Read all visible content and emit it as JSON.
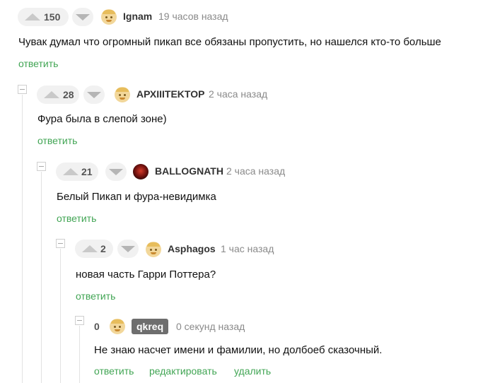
{
  "comments": [
    {
      "score": "150",
      "username": "Ignam",
      "time": "19 часов назад",
      "text": "Чувак думал что огромный пикап все обязаны пропустить, но нашелся кто-то больше",
      "actions": [
        "ответить"
      ]
    },
    {
      "score": "28",
      "username": "АРХIIITEKTOP",
      "time": "2 часа назад",
      "text": "Фура была в слепой зоне)",
      "actions": [
        "ответить"
      ]
    },
    {
      "score": "21",
      "username": "BALLOGNATH",
      "time": "2 часа назад",
      "text": "Белый Пикап и фура-невидимка",
      "actions": [
        "ответить"
      ]
    },
    {
      "score": "2",
      "username": "Asphagos",
      "time": "1 час назад",
      "text": "новая часть Гарри Поттера?",
      "actions": [
        "ответить"
      ]
    },
    {
      "score": "0",
      "username": "qkreq",
      "time": "0 секунд назад",
      "text": "Не знаю насчет имени и фамилии, но долбоеб сказочный.",
      "actions": [
        "ответить",
        "редактировать",
        "удалить"
      ]
    }
  ],
  "icons": {
    "upvote": "upvote-icon",
    "downvote": "downvote-icon",
    "avatar": "avatar-icon",
    "collapse": "collapse-thread-icon"
  },
  "colors": {
    "accent": "#41a554",
    "muted": "#8a8a8a",
    "vote_bg": "#f1f1f1",
    "own_badge": "#6e6e6e"
  }
}
